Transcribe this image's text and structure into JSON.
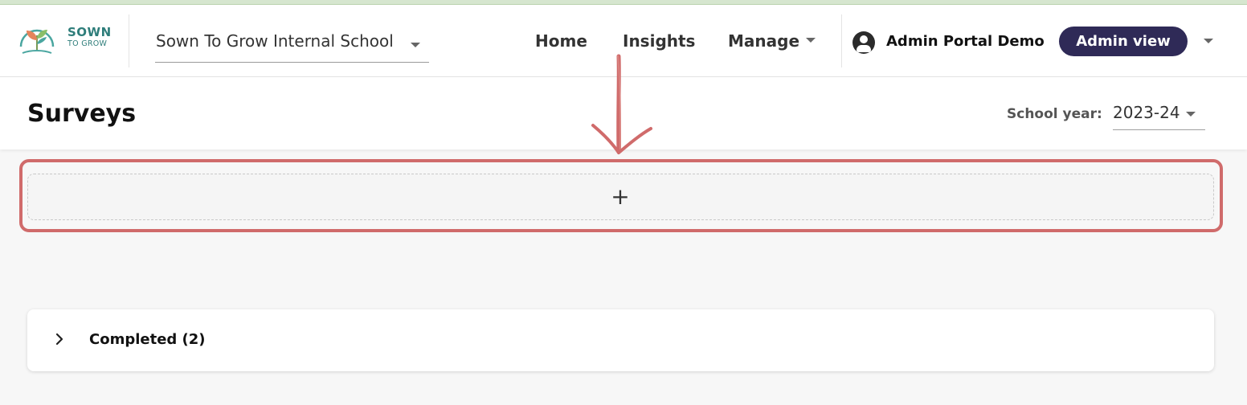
{
  "brand": {
    "line1": "SOWN",
    "line2": "TO GROW",
    "colors": {
      "teal": "#2e7d7a",
      "leaf_orange": "#e5845b",
      "leaf_green": "#8bbf6a",
      "leaf_teal": "#4aa6a0"
    }
  },
  "school_selector": {
    "value": "Sown To Grow Internal School"
  },
  "nav": {
    "items": [
      {
        "label": "Home"
      },
      {
        "label": "Insights"
      },
      {
        "label": "Manage"
      }
    ]
  },
  "account": {
    "name": "Admin Portal Demo",
    "view_badge": "Admin view"
  },
  "page": {
    "title": "Surveys"
  },
  "school_year": {
    "label": "School year:",
    "value": "2023-24"
  },
  "add_survey": {
    "icon_glyph": "+"
  },
  "sections": [
    {
      "label": "Completed (2)"
    }
  ],
  "colors": {
    "accent": "#2f2a57",
    "annotation": "#d06b6b"
  },
  "icons": [
    "sown-to-grow-logo",
    "chevron-down-icon",
    "account-circle-icon",
    "plus-icon",
    "chevron-right-icon",
    "annotation-arrow"
  ]
}
